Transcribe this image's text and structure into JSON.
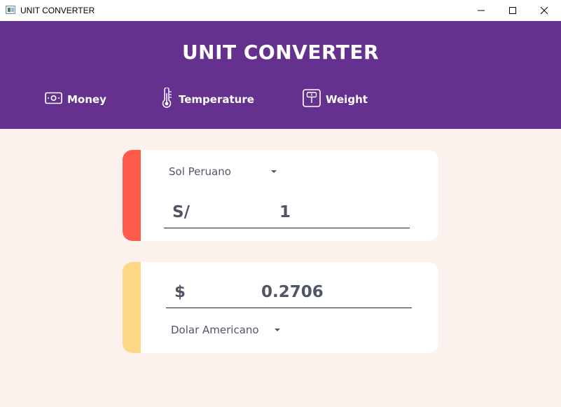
{
  "window": {
    "title": "UNIT CONVERTER",
    "controls": [
      "minimize-icon",
      "maximize-icon",
      "close-icon"
    ]
  },
  "header": {
    "title": "UNIT CONVERTER",
    "background_color": "#65318f",
    "nav": [
      {
        "label": "Money",
        "icon": "money-icon"
      },
      {
        "label": "Temperature",
        "icon": "thermometer-icon"
      },
      {
        "label": "Weight",
        "icon": "scale-icon"
      }
    ]
  },
  "converter": {
    "from": {
      "unit": "Sol Peruano",
      "symbol": "S/",
      "value": "1",
      "accent_color": "#fd5c4d"
    },
    "to": {
      "unit": "Dolar Americano",
      "symbol": "$",
      "value": "0.2706",
      "accent_color": "#fdd785"
    },
    "background_color": "#fcf1ec"
  }
}
